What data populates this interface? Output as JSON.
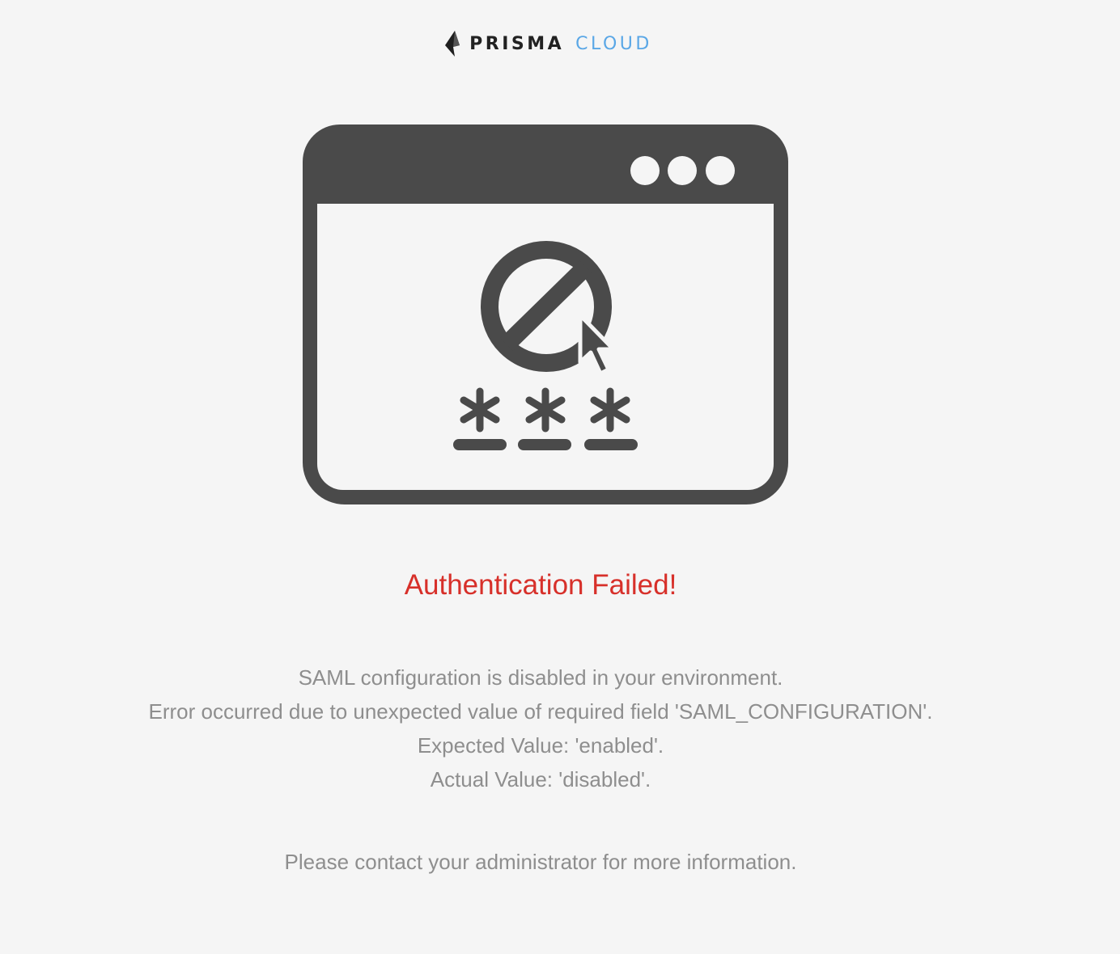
{
  "brand": {
    "name_primary": "PRISMA",
    "name_secondary": "CLOUD"
  },
  "colors": {
    "background": "#f5f5f5",
    "error_title": "#d7302a",
    "message_text": "#8e8e8e",
    "brand_accent": "#5aa7e6",
    "illustration": "#4a4a4a"
  },
  "illustration": {
    "icon": "browser-window-blocked-login-icon"
  },
  "title": "Authentication Failed!",
  "message_lines": [
    "SAML configuration is disabled in your environment.",
    "Error occurred due to unexpected value of required field 'SAML_CONFIGURATION'.",
    "Expected Value: 'enabled'.",
    "Actual Value: 'disabled'."
  ],
  "contact": "Please contact your administrator for more information."
}
